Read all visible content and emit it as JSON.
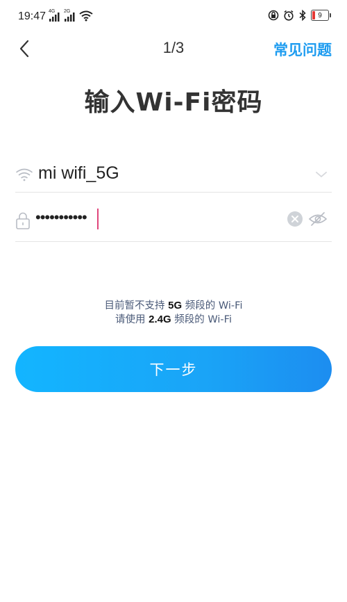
{
  "status_bar": {
    "time": "19:47",
    "network1": "4G",
    "network2": "2G",
    "battery_level": "9"
  },
  "nav": {
    "step": "1/3",
    "faq_label": "常见问题"
  },
  "title": "输入Wi-Fi密码",
  "ssid": {
    "value": "mi wifi_5G"
  },
  "password": {
    "masked_value": "•••••••••••"
  },
  "notice": {
    "line1_prefix": "目前暂不支持",
    "line1_band": "5G",
    "line1_suffix": "频段的 Wi-Fi",
    "line2_prefix": "请使用",
    "line2_band": "2.4G",
    "line2_suffix": "频段的 Wi-Fi"
  },
  "next_button_label": "下一步",
  "colors": {
    "accent": "#1e9cf0",
    "button_start": "#13b5ff",
    "button_end": "#1c8df0",
    "caret": "#e0457b",
    "battery_low": "#e53935"
  }
}
